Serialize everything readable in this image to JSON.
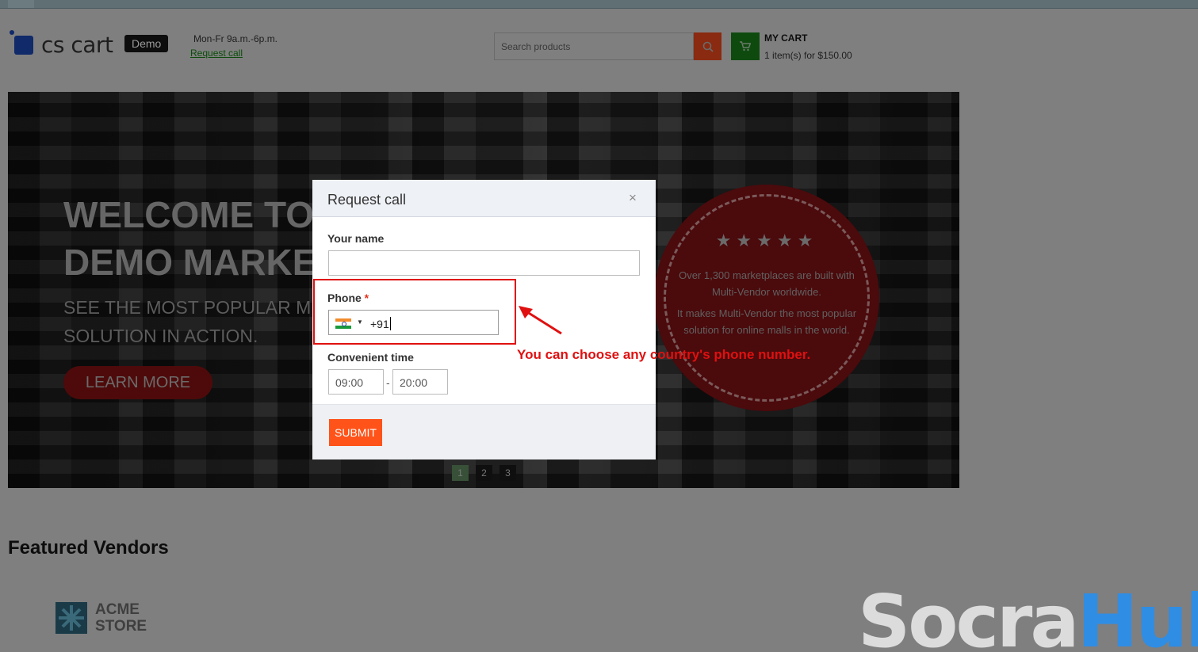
{
  "header": {
    "logo_text": "cs cart",
    "logo_badge": "Demo",
    "hours": "Mon-Fr 9a.m.-6p.m.",
    "request_call_link": "Request call",
    "search_placeholder": "Search products",
    "cart_title": "MY CART",
    "cart_info": "1 item(s) for $150.00"
  },
  "hero": {
    "title_line1": "WELCOME TO",
    "title_line2": "DEMO MARKE",
    "subtitle_line1": "SEE THE MOST POPULAR MUL",
    "subtitle_line2": "SOLUTION IN ACTION.",
    "button_label": "LEARN MORE",
    "badge_stars": "★★★★★",
    "badge_text1": "Over 1,300 marketplaces are built with Multi-Vendor worldwide.",
    "badge_text2": "It makes Multi-Vendor the most popular solution for online malls in the world.",
    "slides": [
      "1",
      "2",
      "3"
    ],
    "active_slide": "1"
  },
  "featured": {
    "title": "Featured Vendors",
    "vendor_line1": "ACME",
    "vendor_line2": "STORE"
  },
  "modal": {
    "title": "Request call",
    "close": "×",
    "name_label": "Your name",
    "phone_label": "Phone",
    "required_mark": "*",
    "phone_value": "+91",
    "time_label": "Convenient time",
    "time_from": "09:00",
    "time_sep": "-",
    "time_to": "20:00",
    "submit_label": "SUBMIT"
  },
  "annotation": {
    "text": "You can choose any country's phone number.",
    "color": "#e01010"
  },
  "watermark": {
    "part1": "Socra",
    "part2": "Hub"
  },
  "colors": {
    "submit": "#ff5319",
    "required": "#e2321c",
    "watermark_blue": "#2f8de4"
  }
}
